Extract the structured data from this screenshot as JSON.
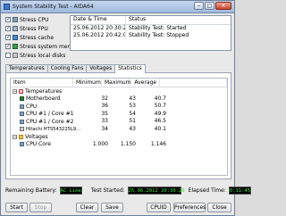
{
  "window": {
    "title": "System Stability Test - AIDA64",
    "close_label": "✕",
    "min_label": "‒",
    "max_label": "□"
  },
  "stress_options": [
    {
      "label": "Stress CPU",
      "checked": true
    },
    {
      "label": "Stress FPU",
      "checked": true
    },
    {
      "label": "Stress cache",
      "checked": true
    },
    {
      "label": "Stress system memory",
      "checked": true
    },
    {
      "label": "Stress local disks",
      "checked": false
    }
  ],
  "log": {
    "columns": [
      "Date & Time",
      "Status"
    ],
    "rows": [
      {
        "datetime": "25.06.2012 20:30:20",
        "status": "Stability Test: Started"
      },
      {
        "datetime": "25.06.2012 20:42:05",
        "status": "Stability Test: Stopped"
      }
    ]
  },
  "tabs": [
    "Temperatures",
    "Cooling Fans",
    "Voltages",
    "Statistics"
  ],
  "active_tab": "Statistics",
  "stats": {
    "columns": [
      "Item",
      "Minimum",
      "Maximum",
      "Average"
    ],
    "groups": [
      {
        "label": "Temperatures",
        "rows": [
          {
            "item": "Motherboard",
            "min": "32",
            "max": "43",
            "avg": "40.7",
            "icon": "mb"
          },
          {
            "item": "CPU",
            "min": "36",
            "max": "53",
            "avg": "50.7",
            "icon": "cpu"
          },
          {
            "item": "CPU #1 / Core #1",
            "min": "35",
            "max": "54",
            "avg": "49.9",
            "icon": "cpu"
          },
          {
            "item": "CPU #1 / Core #2",
            "min": "33",
            "max": "51",
            "avg": "46.5",
            "icon": "cpu"
          },
          {
            "item": "Hitachi HTS543225L9...",
            "min": "34",
            "max": "43",
            "avg": "40.1",
            "icon": "hdd"
          }
        ]
      },
      {
        "label": "Voltages",
        "rows": [
          {
            "item": "CPU Core",
            "min": "1.000",
            "max": "1.150",
            "avg": "1.146",
            "icon": "cpu"
          }
        ]
      }
    ]
  },
  "status": {
    "battery_label": "Remaining Battery:",
    "battery_value": "AC Line",
    "started_label": "Test Started:",
    "started_value": "25.06.2012 20:30:20",
    "elapsed_label": "Elapsed Time:",
    "elapsed_value": "0:11:45"
  },
  "buttons": {
    "start": "Start",
    "stop": "Stop",
    "clear": "Clear",
    "save": "Save",
    "cpuid": "CPUID",
    "preferences": "Preferences",
    "close": "Close"
  }
}
